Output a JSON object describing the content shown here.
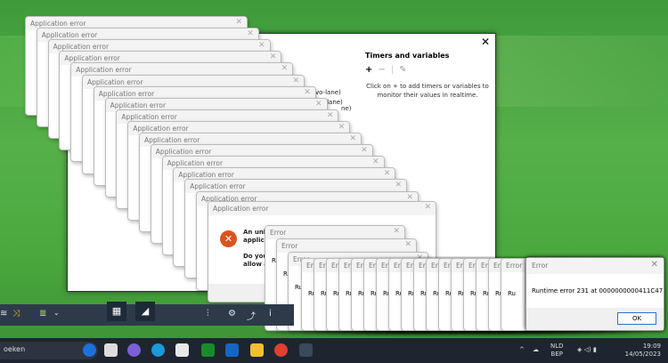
{
  "main_window": {
    "timers_title": "Timers and variables",
    "add_icon": "+",
    "remove_icon": "−",
    "edit_icon": "✎",
    "hint": "Click on + to add timers or variables to monitor their values in realtime.",
    "lanes": [
      "vo-lane)",
      "vo-lane)",
      "ne)"
    ]
  },
  "app_error": {
    "title": "Application error",
    "count": 17,
    "message_1": "An unk",
    "message_2": "applica",
    "message_3": "Do you",
    "message_4": "allow a"
  },
  "error_dialogs": {
    "title": "Error",
    "body_partial": "Ru",
    "large_count": 3,
    "small_count": 17
  },
  "final_dialog": {
    "title": "Error",
    "message": "Runtime error 231 at 0000000000411C47",
    "ok_label": "OK"
  },
  "taskbar": {
    "search_text": "oeken",
    "language": "NLD",
    "layout": "BEP",
    "time": "19:09",
    "date": "14/05/2023"
  }
}
